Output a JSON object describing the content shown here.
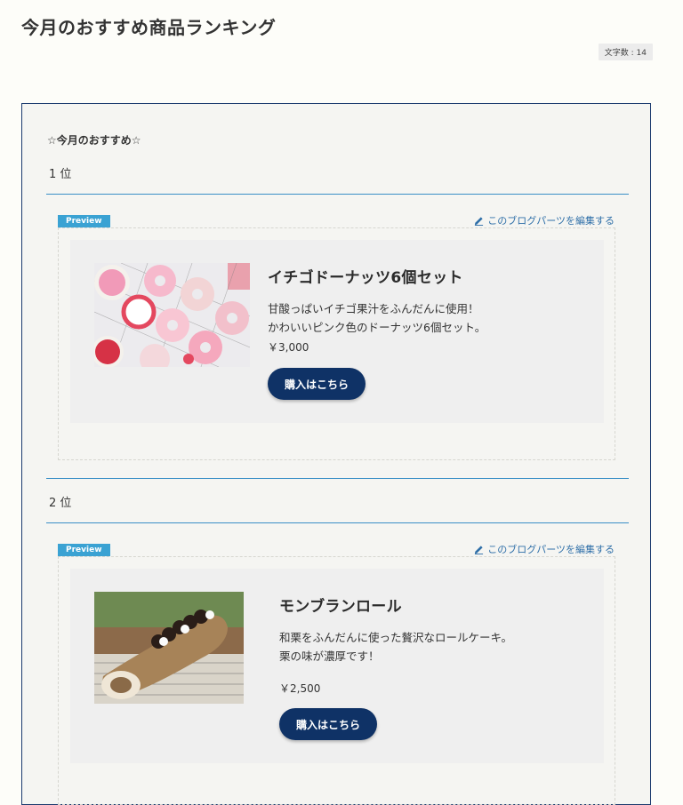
{
  "page": {
    "title": "今月のおすすめ商品ランキング",
    "char_count": "文字数 : 14"
  },
  "content": {
    "intro_heading": "☆今月のおすすめ☆",
    "products": [
      {
        "rank": "1 位",
        "preview_tag": "Preview",
        "edit_link": "このブログパーツを編集する",
        "title": "イチゴドーナッツ6個セット",
        "desc_line1": "甘酸っぱいイチゴ果汁をふんだんに使用！",
        "desc_line2": "かわいいピンク色のドーナッツ6個セット。",
        "price": "￥3,000",
        "button": "購入はこちら"
      },
      {
        "rank": "2 位",
        "preview_tag": "Preview",
        "edit_link": "このブログパーツを編集する",
        "title": "モンブランロール",
        "desc_line1": "和栗をふんだんに使った贅沢なロールケーキ。",
        "desc_line2": "栗の味が濃厚です！",
        "price": "￥2,500",
        "button": "購入はこちら"
      }
    ]
  },
  "colors": {
    "accent": "#0f3266",
    "frame_border": "#1b3a6e",
    "divider": "#3a8fc6",
    "preview_tag": "#3aa2d3",
    "link": "#2f6fa8"
  },
  "icons": {
    "edit": "pencil-icon",
    "donut_image": "donut-photo",
    "roll_image": "montblanc-roll-photo"
  }
}
